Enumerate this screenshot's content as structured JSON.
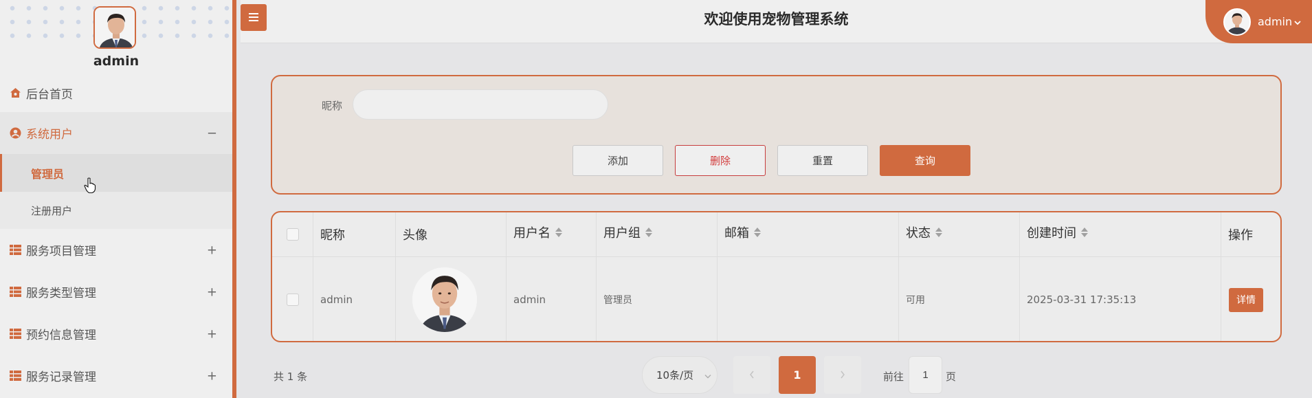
{
  "colors": {
    "accent": "#d06a3f",
    "danger": "#d23a3a"
  },
  "sidebar": {
    "username": "admin",
    "menu": [
      {
        "label": "后台首页",
        "icon": "home-icon"
      },
      {
        "label": "系统用户",
        "icon": "user-circle-icon",
        "toggle": "−",
        "open": true,
        "children": [
          {
            "label": "管理员",
            "active": true
          },
          {
            "label": "注册用户"
          }
        ]
      },
      {
        "label": "服务项目管理",
        "icon": "grid-icon",
        "toggle": "+"
      },
      {
        "label": "服务类型管理",
        "icon": "grid-icon",
        "toggle": "+"
      },
      {
        "label": "预约信息管理",
        "icon": "grid-icon",
        "toggle": "+"
      },
      {
        "label": "服务记录管理",
        "icon": "grid-icon",
        "toggle": "+"
      }
    ]
  },
  "header": {
    "title": "欢迎使用宠物管理系统",
    "menu_icon": "hamburger-icon",
    "user_label": "admin"
  },
  "search": {
    "nickname_label": "昵称",
    "nickname_value": "",
    "buttons": {
      "add": "添加",
      "delete": "删除",
      "reset": "重置",
      "query": "查询"
    }
  },
  "table": {
    "columns": [
      "昵称",
      "头像",
      "用户名",
      "用户组",
      "邮箱",
      "状态",
      "创建时间",
      "操作"
    ],
    "rows": [
      {
        "nickname": "admin",
        "avatar": "avatar-photo",
        "username": "admin",
        "group": "管理员",
        "email": "",
        "status": "可用",
        "created": "2025-03-31 17:35:13",
        "action": "详情"
      }
    ]
  },
  "pagination": {
    "total_text": "共 1 条",
    "page_size": "10条/页",
    "current_page": "1",
    "goto_prefix": "前往",
    "goto_value": "1",
    "goto_suffix": "页"
  }
}
